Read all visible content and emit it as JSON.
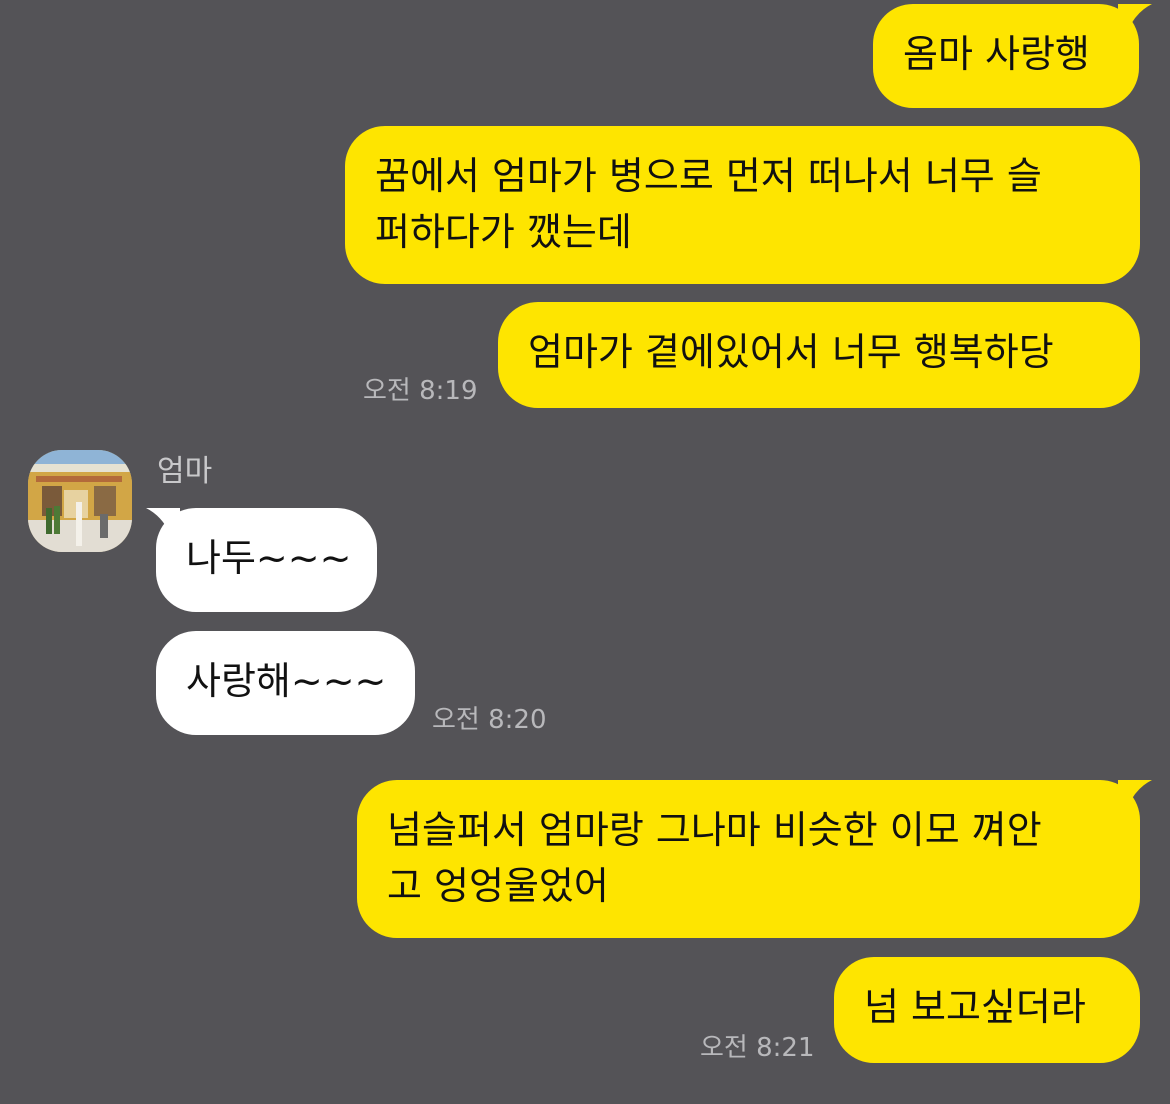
{
  "chat": {
    "messages": [
      {
        "from": "me",
        "text": "옴마 사랑행"
      },
      {
        "from": "me",
        "line1": "꿈에서 엄마가 병으로 먼저 떠나서 너무 슬",
        "line2": "퍼하다가 깼는데"
      },
      {
        "from": "me",
        "text": "엄마가 곁에있어서 너무 행복하당",
        "time": "오전 8:19"
      },
      {
        "from": "mom",
        "sender": "엄마",
        "text": "나두~~~"
      },
      {
        "from": "mom",
        "text": "사랑해~~~",
        "time": "오전 8:20"
      },
      {
        "from": "me",
        "line1": "넘슬퍼서 엄마랑 그나마 비슷한 이모 껴안",
        "line2": "고 엉엉울었어"
      },
      {
        "from": "me",
        "text": "넘 보고싶더라",
        "time": "오전 8:21"
      }
    ]
  },
  "colors": {
    "background": "#545357",
    "my_bubble": "#fee500",
    "their_bubble": "#ffffff",
    "timestamp": "#b8b8bb"
  }
}
